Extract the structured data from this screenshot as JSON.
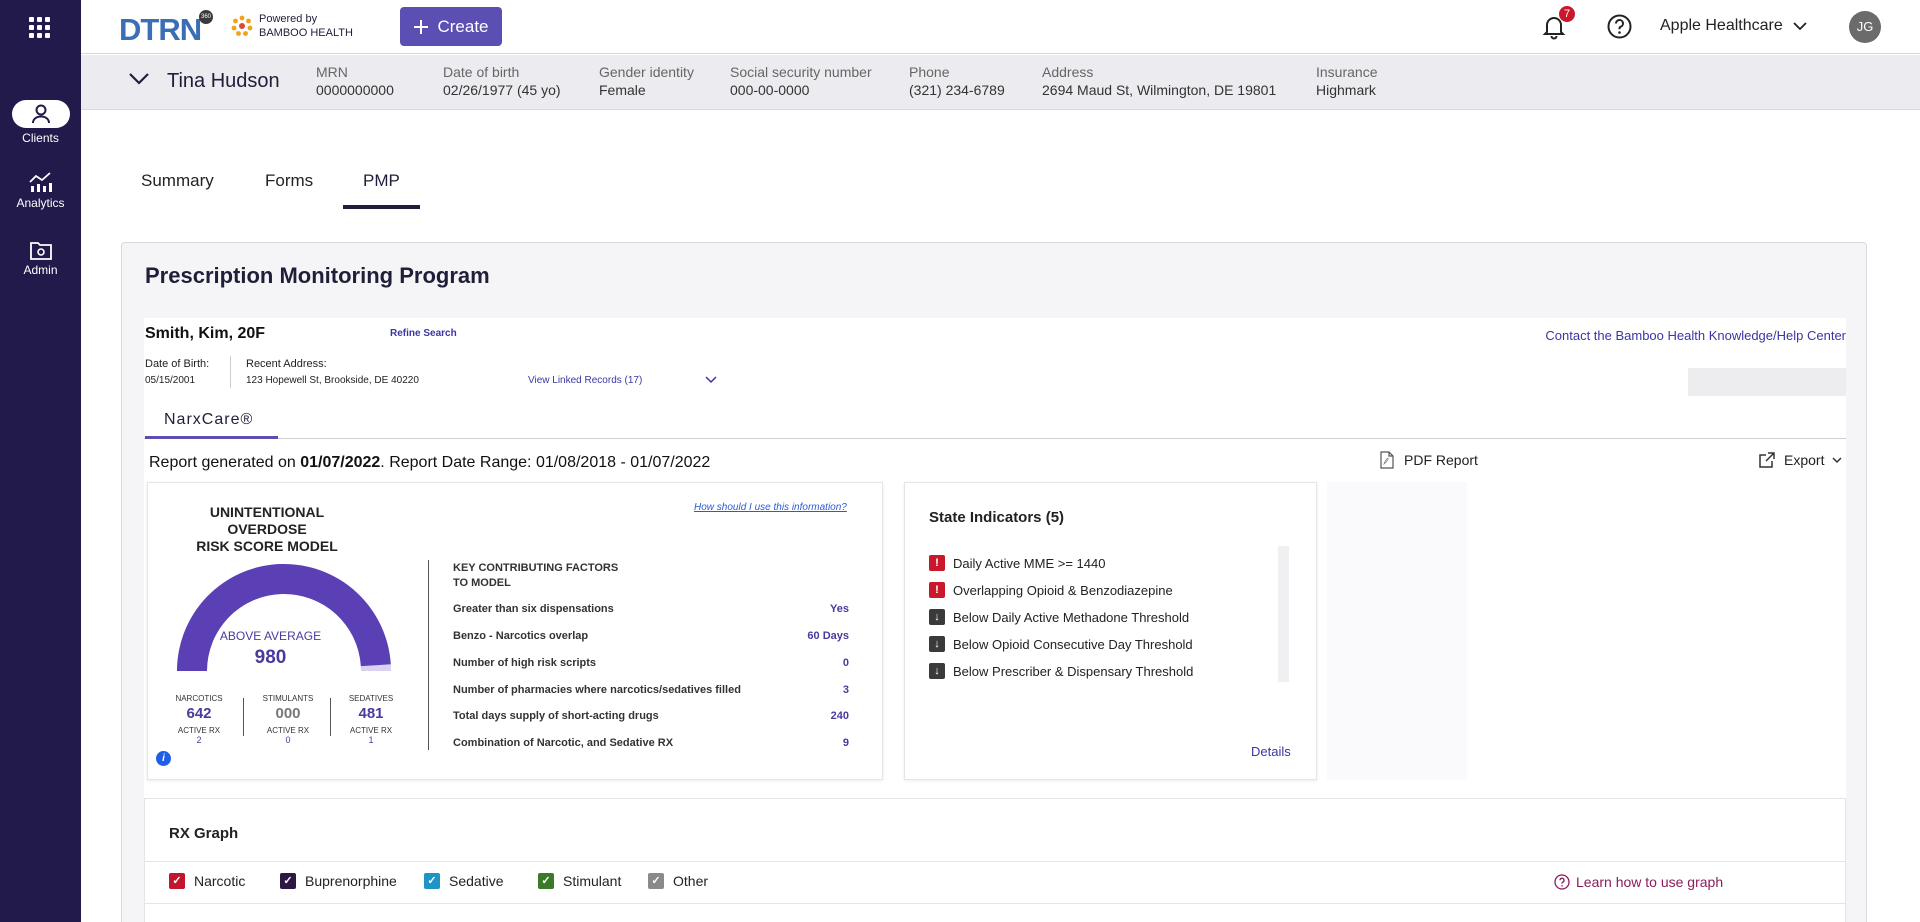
{
  "sidebar": {
    "items": [
      {
        "label": "Clients",
        "icon": "person-icon",
        "active": true
      },
      {
        "label": "Analytics",
        "icon": "analytics-icon",
        "active": false
      },
      {
        "label": "Admin",
        "icon": "admin-folder-icon",
        "active": false
      }
    ]
  },
  "topbar": {
    "logo": "DTRN",
    "logo_badge": "360",
    "powered_line1": "Powered by",
    "powered_line2": "BAMBOO HEALTH",
    "create_label": "Create",
    "notification_count": "7",
    "org_name": "Apple Healthcare",
    "user_initials": "JG"
  },
  "patient": {
    "name": "Tina Hudson",
    "fields": [
      {
        "label": "MRN",
        "value": "0000000000"
      },
      {
        "label": "Date of birth",
        "value": "02/26/1977 (45 yo)"
      },
      {
        "label": "Gender identity",
        "value": "Female"
      },
      {
        "label": "Social security number",
        "value": "000-00-0000"
      },
      {
        "label": "Phone",
        "value": "(321) 234-6789"
      },
      {
        "label": "Address",
        "value": "2694 Maud St, Wilmington, DE 19801"
      },
      {
        "label": "Insurance",
        "value": "Highmark"
      }
    ]
  },
  "tabs": [
    {
      "label": "Summary",
      "active": false
    },
    {
      "label": "Forms",
      "active": false
    },
    {
      "label": "PMP",
      "active": true
    }
  ],
  "pmp": {
    "title": "Prescription Monitoring Program",
    "subject_name": "Smith, Kim, 20F",
    "refine_search": "Refine Search",
    "contact_link": "Contact the Bamboo Health Knowledge/Help Center",
    "dob_label": "Date of Birth:",
    "dob_value": "05/15/2001",
    "address_label": "Recent Address:",
    "address_value": "123 Hopewell St, Brookside, DE 40220",
    "linked_records": "View Linked Records (17)",
    "narx_tab": "NarxCare®",
    "report_prefix": "Report generated on ",
    "report_date": "01/07/2022",
    "report_suffix": ". Report Date Range: 01/08/2018 - 01/07/2022",
    "pdf_report": "PDF Report",
    "export": "Export"
  },
  "risk_model": {
    "title_line1": "UNINTENTIONAL OVERDOSE",
    "title_line2": "RISK SCORE MODEL",
    "how_link": "How should I use this information?",
    "level": "ABOVE AVERAGE",
    "score": "980",
    "score_fraction": 0.98,
    "drugs": [
      {
        "name": "NARCOTICS",
        "value": "642",
        "active_label": "ACTIVE RX",
        "active_value": "2"
      },
      {
        "name": "STIMULANTS",
        "value": "000",
        "active_label": "ACTIVE RX",
        "active_value": "0"
      },
      {
        "name": "SEDATIVES",
        "value": "481",
        "active_label": "ACTIVE RX",
        "active_value": "1"
      }
    ],
    "factors_title_line1": "KEY CONTRIBUTING FACTORS",
    "factors_title_line2": "TO MODEL",
    "factors": [
      {
        "label": "Greater than six dispensations",
        "value": "Yes"
      },
      {
        "label": "Benzo - Narcotics overlap",
        "value": "60 Days"
      },
      {
        "label": "Number of high risk scripts",
        "value": "0"
      },
      {
        "label": "Number of pharmacies where narcotics/sedatives filled",
        "value": "3"
      },
      {
        "label": "Total days supply of short-acting drugs",
        "value": "240"
      },
      {
        "label": "Combination of Narcotic, and Sedative RX",
        "value": "9"
      }
    ]
  },
  "state_indicators": {
    "title": "State Indicators (5)",
    "items": [
      {
        "label": "Daily Active MME >= 1440",
        "severity": "alert"
      },
      {
        "label": "Overlapping Opioid & Benzodiazepine",
        "severity": "alert"
      },
      {
        "label": "Below Daily Active Methadone Threshold",
        "severity": "below"
      },
      {
        "label": "Below Opioid Consecutive Day Threshold",
        "severity": "below"
      },
      {
        "label": "Below Prescriber & Dispensary Threshold",
        "severity": "below"
      }
    ],
    "details": "Details"
  },
  "rx_graph": {
    "title": "RX Graph",
    "legend": [
      {
        "label": "Narcotic",
        "color": "#c0172f"
      },
      {
        "label": "Buprenorphine",
        "color": "#2d1843"
      },
      {
        "label": "Sedative",
        "color": "#1e95c4"
      },
      {
        "label": "Stimulant",
        "color": "#3a7a2a"
      },
      {
        "label": "Other",
        "color": "#8a8a8a"
      }
    ],
    "learn_link": "Learn how to use graph"
  }
}
